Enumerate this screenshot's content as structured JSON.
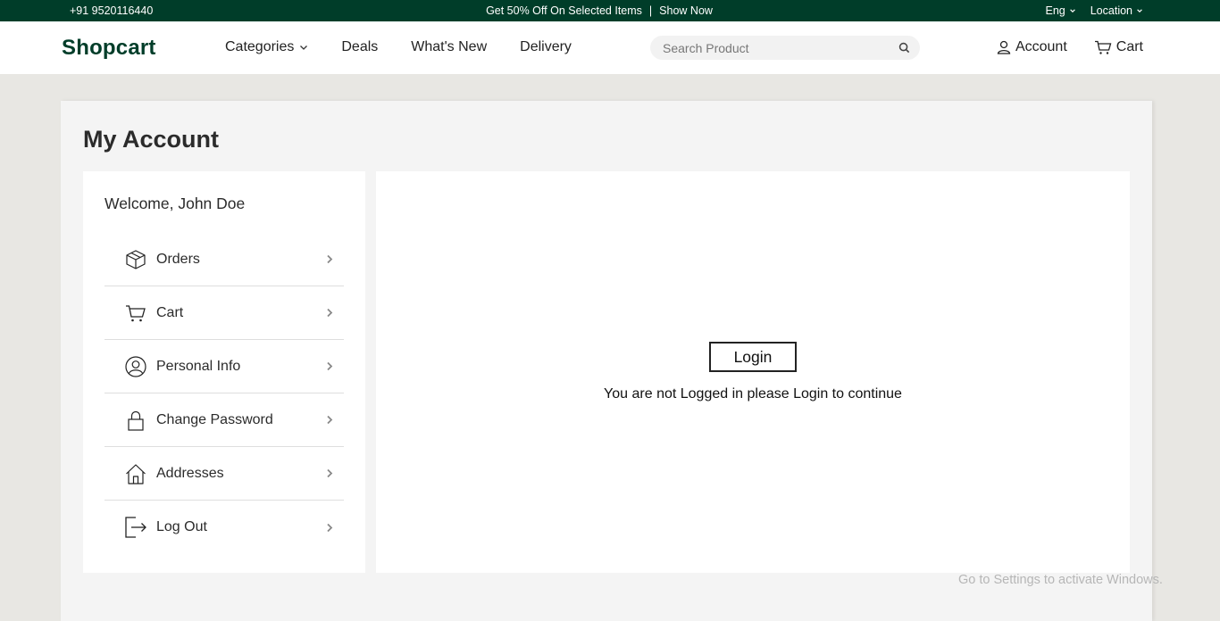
{
  "topbar": {
    "phone": "+91 9520116440",
    "promo": "Get 50% Off On Selected Items",
    "promo_divider": "|",
    "promo_link": "Show Now",
    "language": "Eng",
    "location": "Location"
  },
  "header": {
    "logo": "Shopcart",
    "nav": {
      "categories": "Categories",
      "deals": "Deals",
      "whats_new": "What's New",
      "delivery": "Delivery"
    },
    "search_placeholder": "Search Product",
    "account": "Account",
    "cart": "Cart"
  },
  "page": {
    "title": "My Account",
    "welcome": "Welcome, John Doe",
    "menu": [
      {
        "label": "Orders",
        "icon": "box-icon"
      },
      {
        "label": "Cart",
        "icon": "cart-icon"
      },
      {
        "label": "Personal Info",
        "icon": "user-circle-icon"
      },
      {
        "label": "Change Password",
        "icon": "lock-icon"
      },
      {
        "label": "Addresses",
        "icon": "home-icon"
      },
      {
        "label": "Log Out",
        "icon": "logout-icon"
      }
    ],
    "login_button": "Login",
    "login_message": "You are not Logged in please Login to continue"
  },
  "watermark": "Go to Settings to activate Windows.",
  "colors": {
    "brand": "#003d29",
    "background": "#e8e7e3",
    "panel": "#f4f4f4"
  }
}
